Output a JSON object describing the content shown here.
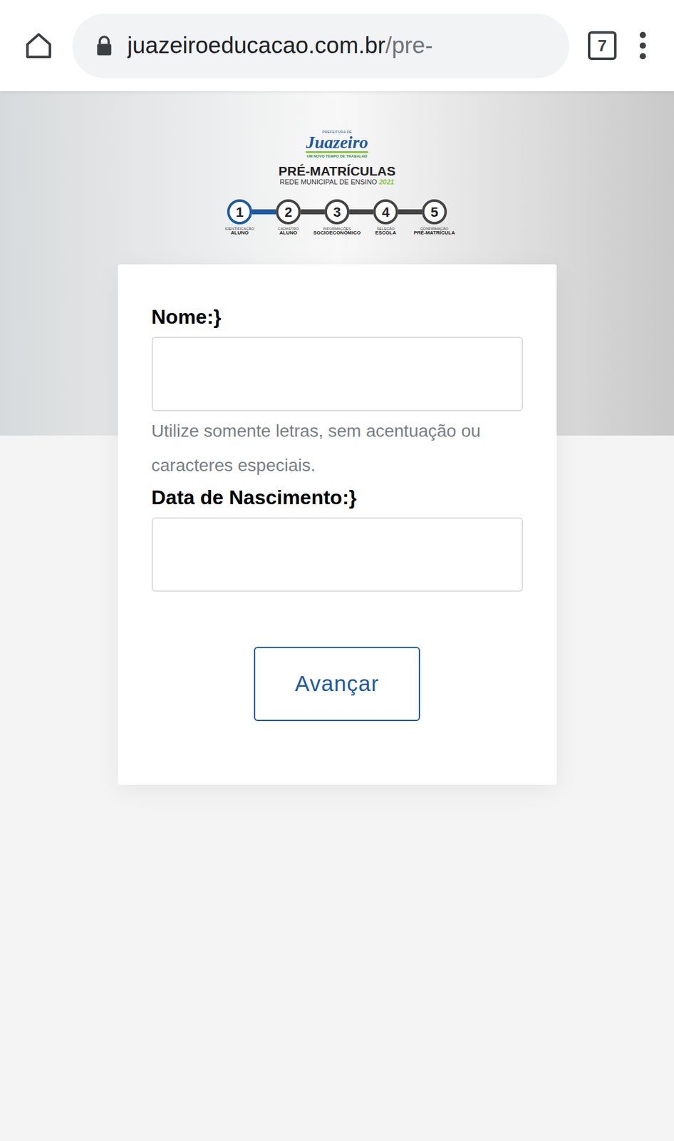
{
  "browser": {
    "url_host": "juazeiroeducacao.com.br",
    "url_path": "/pre-",
    "tab_count": "7"
  },
  "logo": {
    "top": "PREFEITURA DE",
    "name": "Juazeiro",
    "slogan": "UM NOVO TEMPO DE TRABALHO",
    "title": "PRÉ-MATRÍCULAS",
    "subtitle": "REDE MUNICIPAL DE ENSINO",
    "year": "2021"
  },
  "steps": [
    {
      "number": "1",
      "line1": "IDENTIFICAÇÃO",
      "line2": "ALUNO",
      "selected": true
    },
    {
      "number": "2",
      "line1": "CADASTRO",
      "line2": "ALUNO",
      "selected": false
    },
    {
      "number": "3",
      "line1": "INFORMAÇÕES",
      "line2": "SOCIOECONÔMICO",
      "selected": false
    },
    {
      "number": "4",
      "line1": "SELEÇÃO",
      "line2": "ESCOLA",
      "selected": false
    },
    {
      "number": "5",
      "line1": "CONFIRMAÇÃO",
      "line2": "PRÉ-MATRÍCULA",
      "selected": false
    }
  ],
  "form": {
    "fields": [
      {
        "label": "Nome:",
        "value": "",
        "hint": "Utilize somente letras, sem acentuação ou caracteres especiais."
      },
      {
        "label": "Data de Nascimento:",
        "value": "",
        "hint": ""
      }
    ],
    "button": "Avançar"
  }
}
